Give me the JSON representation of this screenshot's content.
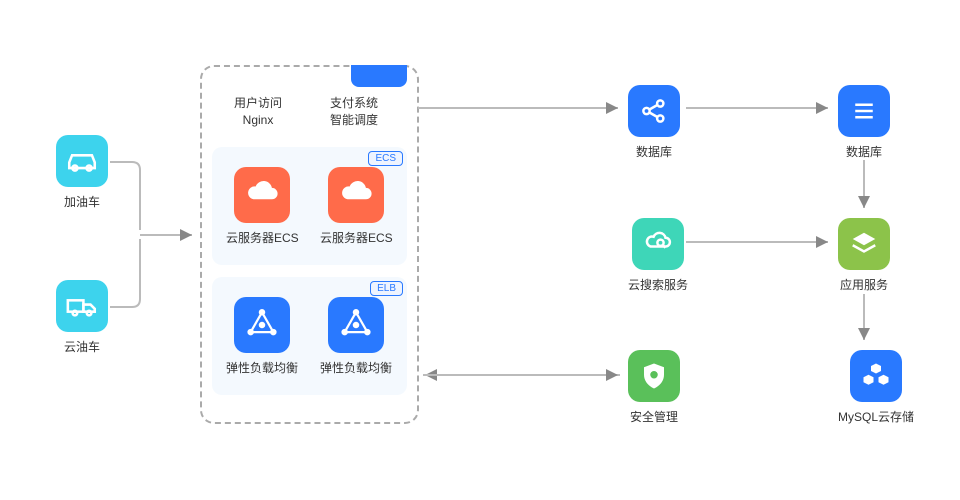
{
  "left": {
    "car": "加油车",
    "truck": "云油车"
  },
  "container": {
    "topLeft": {
      "line1": "用户访问",
      "line2": "Nginx"
    },
    "topRight": {
      "line1": "支付系统",
      "line2": "智能调度"
    },
    "ecsBadge": "ECS",
    "ecs1": "云服务器ECS",
    "ecs2": "云服务器ECS",
    "elbBadge": "ELB",
    "elb1": "弹性负载均衡",
    "elb2": "弹性负载均衡"
  },
  "right": {
    "dataLibTop": "数据库",
    "dataLibRight": "数据库",
    "cloudSearch": "云搜索服务",
    "security": "安全管理",
    "appService": "应用服务",
    "mysqlStore": "MySQL云存储"
  }
}
